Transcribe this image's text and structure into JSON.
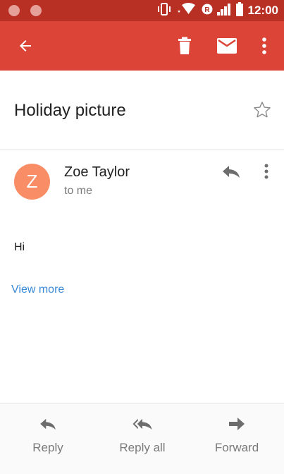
{
  "status_bar": {
    "time": "12:00",
    "icons": [
      "notification-dot-icon",
      "notification-dot-icon",
      "vibrate-icon",
      "wifi-icon",
      "roaming-icon",
      "signal-icon",
      "battery-icon"
    ]
  },
  "app_bar": {
    "back_icon": "arrow-back-icon",
    "delete_icon": "trash-icon",
    "mark_unread_icon": "mail-icon",
    "more_icon": "more-vert-icon"
  },
  "email": {
    "subject": "Holiday picture",
    "star_icon": "star-outline-icon",
    "sender": {
      "initial": "Z",
      "name": "Zoe Taylor",
      "recipient": "to me",
      "avatar_color": "#f98d65"
    },
    "body": "Hi",
    "view_more": "View more"
  },
  "bottom_actions": {
    "reply": "Reply",
    "reply_all": "Reply all",
    "forward": "Forward"
  },
  "colors": {
    "status_bar": "#b82f24",
    "app_bar": "#db4437",
    "link": "#3a8ad6"
  }
}
